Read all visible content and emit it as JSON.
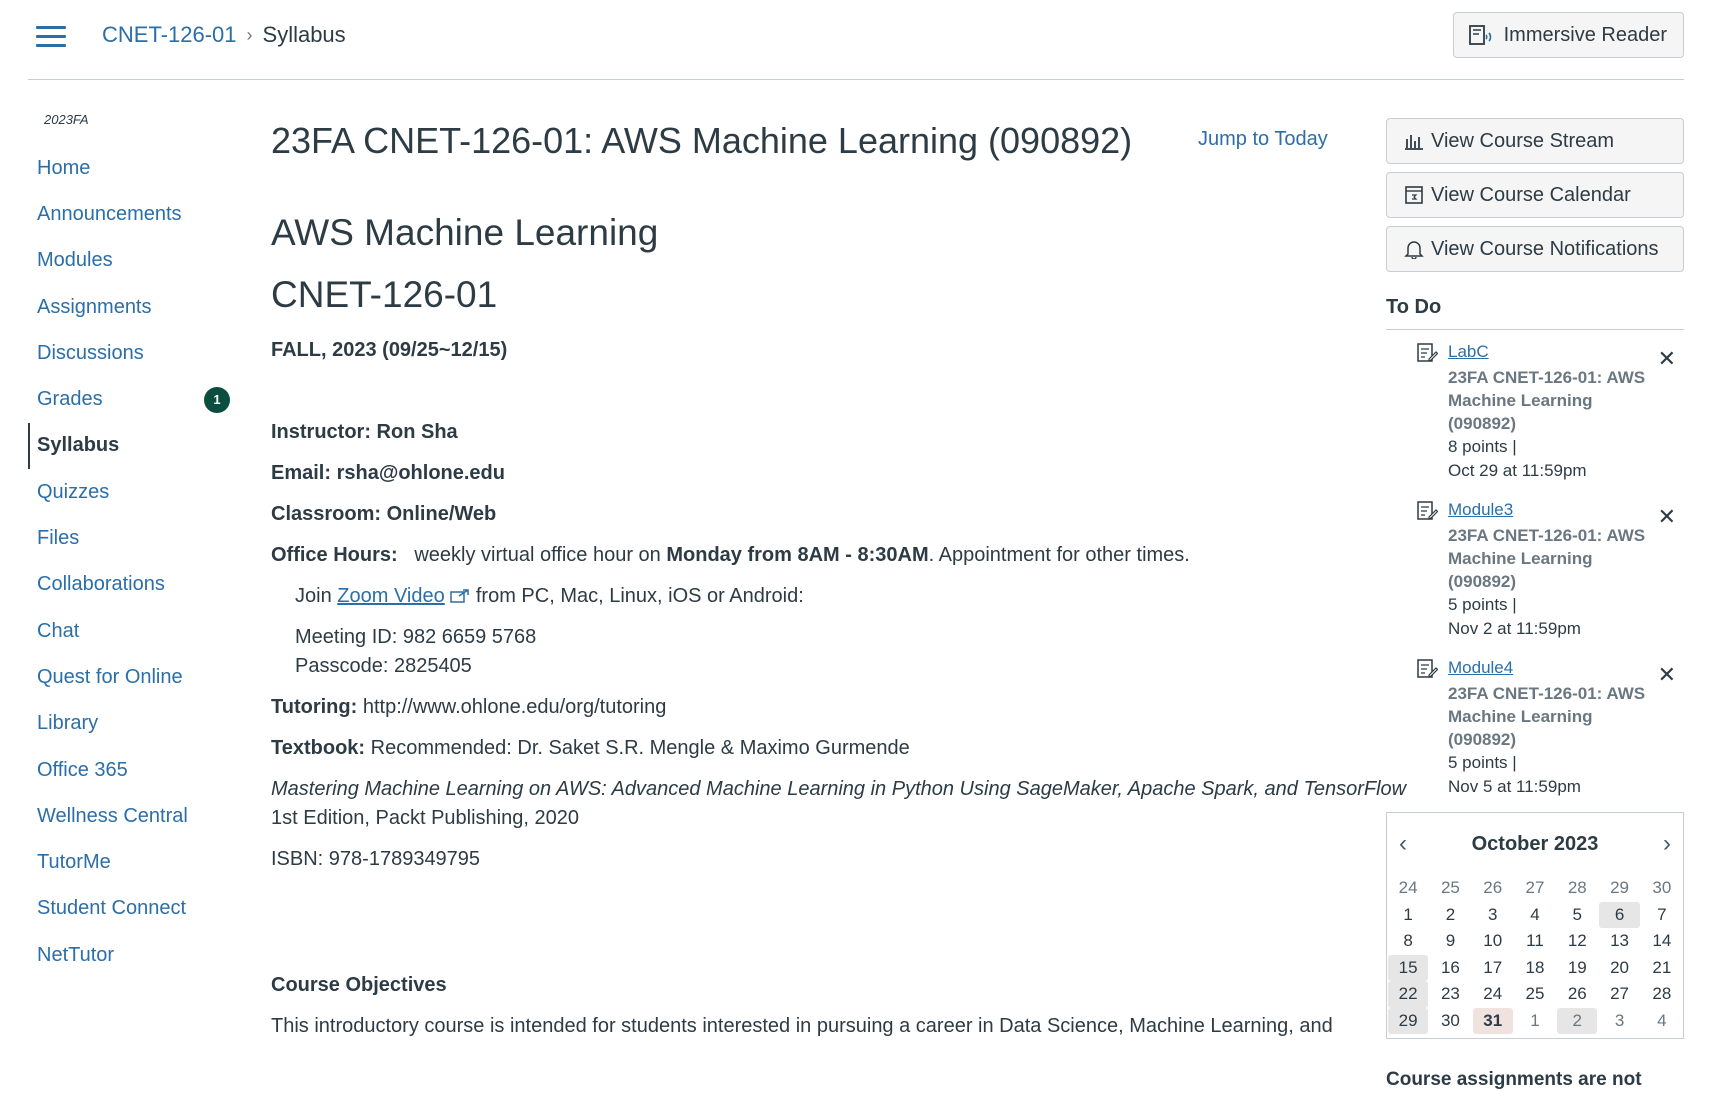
{
  "header": {
    "crumb_course": "CNET-126-01",
    "crumb_current": "Syllabus",
    "immersive_label": "Immersive Reader"
  },
  "nav": {
    "term": "2023FA",
    "items": [
      {
        "label": "Home"
      },
      {
        "label": "Announcements"
      },
      {
        "label": "Modules"
      },
      {
        "label": "Assignments"
      },
      {
        "label": "Discussions"
      },
      {
        "label": "Grades",
        "badge": "1"
      },
      {
        "label": "Syllabus",
        "active": true
      },
      {
        "label": "Quizzes"
      },
      {
        "label": "Files"
      },
      {
        "label": "Collaborations"
      },
      {
        "label": "Chat"
      },
      {
        "label": "Quest for Online"
      },
      {
        "label": "Library"
      },
      {
        "label": "Office 365"
      },
      {
        "label": "Wellness Central"
      },
      {
        "label": "TutorMe"
      },
      {
        "label": "Student Connect"
      },
      {
        "label": "NetTutor"
      }
    ]
  },
  "main": {
    "title": "23FA CNET-126-01: AWS Machine Learning (090892)",
    "jump_label": "Jump to Today",
    "heading1": "AWS Machine Learning",
    "heading2": "CNET-126-01",
    "term_dates": "FALL, 2023 (09/25~12/15)",
    "instructor": "Instructor: Ron Sha",
    "email": "Email: rsha@ohlone.edu",
    "classroom": "Classroom: Online/Web",
    "office_label": "Office Hours:",
    "office_text1": "weekly virtual office hour on",
    "office_bold": "Monday from 8AM - 8:30AM",
    "office_text2": ".   Appointment for other times.",
    "join_pre": "Join",
    "join_link": "Zoom Video",
    "join_post": "from PC, Mac, Linux, iOS or Android:",
    "meeting_id": "Meeting ID: 982 6659 5768",
    "passcode": "Passcode: 2825405",
    "tutoring_label": "Tutoring:",
    "tutoring_url": "http://www.ohlone.edu/org/tutoring",
    "textbook_label": "Textbook:",
    "textbook_text": "Recommended: Dr. Saket S.R. Mengle & Maximo Gurmende",
    "book_title": "Mastering Machine Learning on AWS: Advanced Machine Learning in Python Using SageMaker, Apache Spark, and TensorFlow",
    "book_edition": "1st Edition, Packt Publishing, 2020",
    "isbn": "ISBN: 978-1789349795",
    "objectives_heading": "Course Objectives",
    "objectives_text": "This introductory course is intended for students interested in pursuing a career in Data Science, Machine Learning, and"
  },
  "sidebar": {
    "buttons": [
      {
        "label": "View Course Stream",
        "icon": "stream-icon"
      },
      {
        "label": "View Course Calendar",
        "icon": "calendar-icon"
      },
      {
        "label": "View Course Notifications",
        "icon": "bell-icon"
      }
    ],
    "todo_heading": "To Do",
    "todos": [
      {
        "title": "LabC",
        "course": "23FA CNET-126-01: AWS Machine Learning (090892)",
        "points": "8 points  |",
        "due": "Oct 29 at 11:59pm"
      },
      {
        "title": "Module3",
        "course": "23FA CNET-126-01: AWS Machine Learning (090892)",
        "points": "5 points  |",
        "due": "Nov 2 at 11:59pm"
      },
      {
        "title": "Module4",
        "course": "23FA CNET-126-01: AWS Machine Learning (090892)",
        "points": "5 points  |",
        "due": "Nov 5 at 11:59pm"
      }
    ],
    "calendar": {
      "month": "October 2023",
      "days": [
        {
          "d": "24",
          "c": "other"
        },
        {
          "d": "25",
          "c": "other"
        },
        {
          "d": "26",
          "c": "other"
        },
        {
          "d": "27",
          "c": "other"
        },
        {
          "d": "28",
          "c": "other"
        },
        {
          "d": "29",
          "c": "other"
        },
        {
          "d": "30",
          "c": "other"
        },
        {
          "d": "1"
        },
        {
          "d": "2"
        },
        {
          "d": "3"
        },
        {
          "d": "4"
        },
        {
          "d": "5"
        },
        {
          "d": "6",
          "c": "hl"
        },
        {
          "d": "7"
        },
        {
          "d": "8"
        },
        {
          "d": "9"
        },
        {
          "d": "10"
        },
        {
          "d": "11"
        },
        {
          "d": "12"
        },
        {
          "d": "13"
        },
        {
          "d": "14"
        },
        {
          "d": "15",
          "c": "hl"
        },
        {
          "d": "16"
        },
        {
          "d": "17"
        },
        {
          "d": "18"
        },
        {
          "d": "19"
        },
        {
          "d": "20"
        },
        {
          "d": "21"
        },
        {
          "d": "22",
          "c": "hl"
        },
        {
          "d": "23"
        },
        {
          "d": "24"
        },
        {
          "d": "25"
        },
        {
          "d": "26"
        },
        {
          "d": "27"
        },
        {
          "d": "28"
        },
        {
          "d": "29",
          "c": "hl"
        },
        {
          "d": "30"
        },
        {
          "d": "31",
          "c": "today"
        },
        {
          "d": "1",
          "c": "other"
        },
        {
          "d": "2",
          "c": "other hl"
        },
        {
          "d": "3",
          "c": "other"
        },
        {
          "d": "4",
          "c": "other"
        }
      ]
    },
    "note": "Course assignments are not"
  }
}
